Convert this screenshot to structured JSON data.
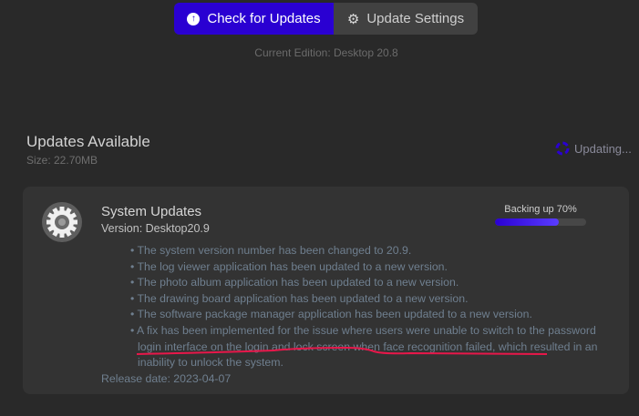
{
  "toolbar": {
    "check_label": "Check for Updates",
    "settings_label": "Update Settings"
  },
  "current_edition": "Current Edition:  Desktop 20.8",
  "updates": {
    "heading": "Updates Available",
    "size": "Size: 22.70MB",
    "status": "Updating..."
  },
  "card": {
    "title": "System Updates",
    "version": "Version: Desktop20.9",
    "progress_label": "Backing up 70%",
    "progress_percent": 70,
    "notes": [
      "The system version number has been changed to 20.9.",
      "The log viewer application has been updated to a new version.",
      "The photo album application has been updated to a new version.",
      "The drawing board application has been updated to a new version.",
      "The software package manager application has been updated to a new version.",
      "A fix has been implemented for the issue where users were unable to switch to the password login interface on the login and lock screen when face recognition failed, which resulted in an inability to unlock the system."
    ],
    "release_date": "Release date: 2023-04-07"
  },
  "colors": {
    "accent": "#2a00d2",
    "annotation": "#e8174a"
  }
}
